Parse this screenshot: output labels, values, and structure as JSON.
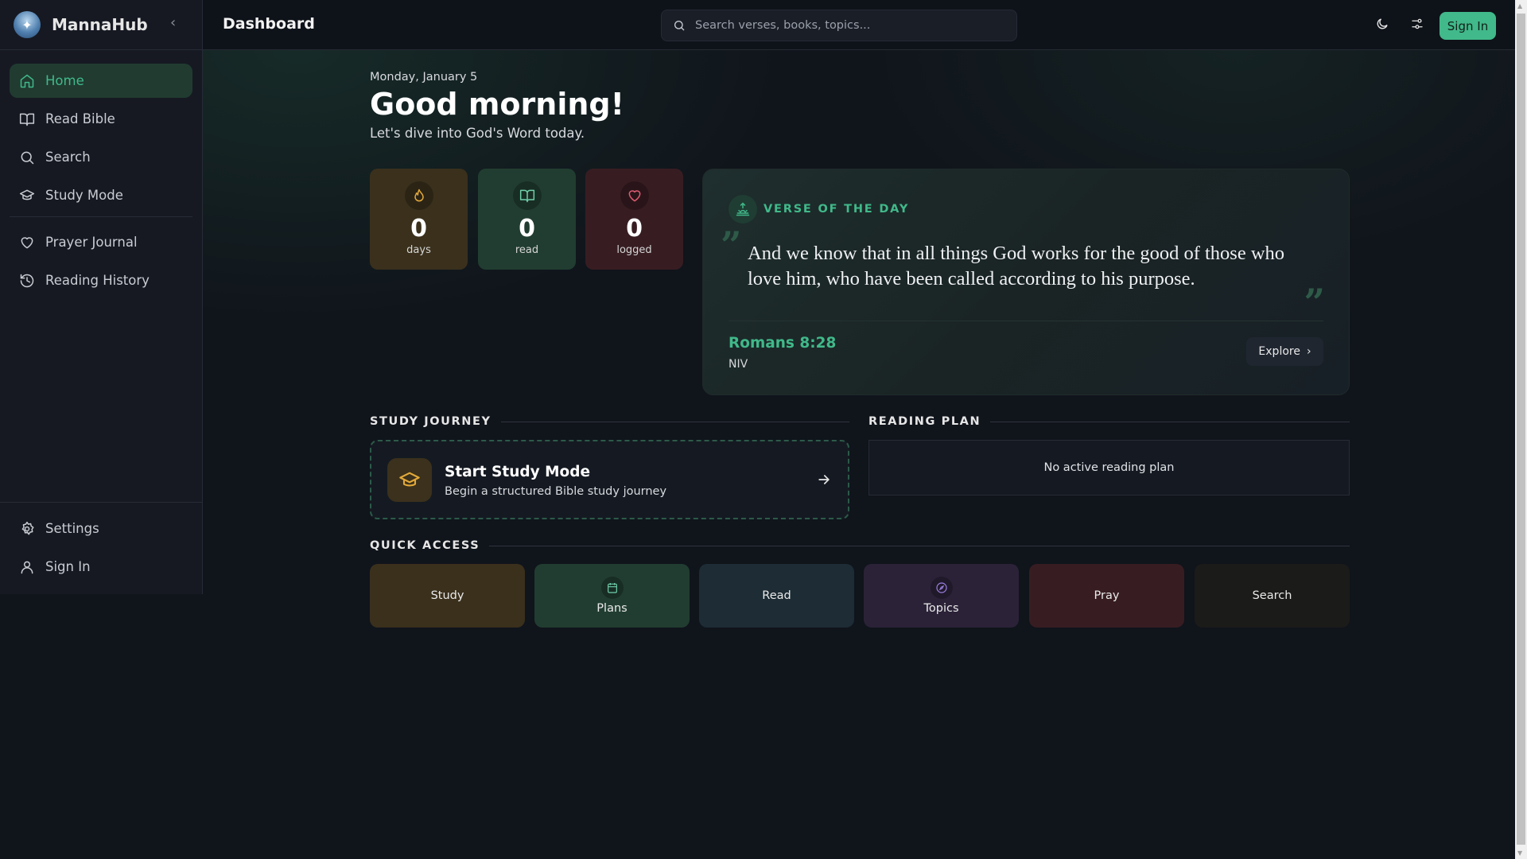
{
  "app": {
    "name": "MannaHub"
  },
  "header": {
    "title": "Dashboard",
    "search_placeholder": "Search verses, books, topics...",
    "sign_in": "Sign In"
  },
  "sidebar": {
    "items": [
      {
        "label": "Home"
      },
      {
        "label": "Read Bible"
      },
      {
        "label": "Search"
      },
      {
        "label": "Study Mode"
      },
      {
        "label": "Prayer Journal"
      },
      {
        "label": "Reading History"
      }
    ],
    "bottom": [
      {
        "label": "Settings"
      },
      {
        "label": "Sign In"
      }
    ]
  },
  "greeting": {
    "date": "Monday, January 5",
    "title": "Good morning!",
    "subtitle": "Let's dive into God's Word today."
  },
  "stats": [
    {
      "value": "0",
      "label": "days"
    },
    {
      "value": "0",
      "label": "read"
    },
    {
      "value": "0",
      "label": "logged"
    }
  ],
  "verse": {
    "heading": "VERSE OF THE DAY",
    "text": "And we know that in all things God works for the good of those who love him, who have been called according to his purpose.",
    "reference": "Romans 8:28",
    "version": "NIV",
    "explore": "Explore",
    "open_quote": "”",
    "close_quote": "”"
  },
  "study_journey": {
    "heading": "STUDY JOURNEY",
    "title": "Start Study Mode",
    "subtitle": "Begin a structured Bible study journey"
  },
  "reading_plan": {
    "heading": "READING PLAN",
    "empty": "No active reading plan"
  },
  "quick_access": {
    "heading": "QUICK ACCESS",
    "tiles": [
      {
        "label": "Study"
      },
      {
        "label": "Plans"
      },
      {
        "label": "Read"
      },
      {
        "label": "Topics"
      },
      {
        "label": "Pray"
      },
      {
        "label": "Search"
      }
    ]
  },
  "colors": {
    "accent": "#41b98a",
    "study": "#3a301c",
    "plans": "#213d31",
    "read": "#1d2c35",
    "topics": "#2b2238",
    "pray": "#371d22",
    "search": "#1b1b19"
  }
}
